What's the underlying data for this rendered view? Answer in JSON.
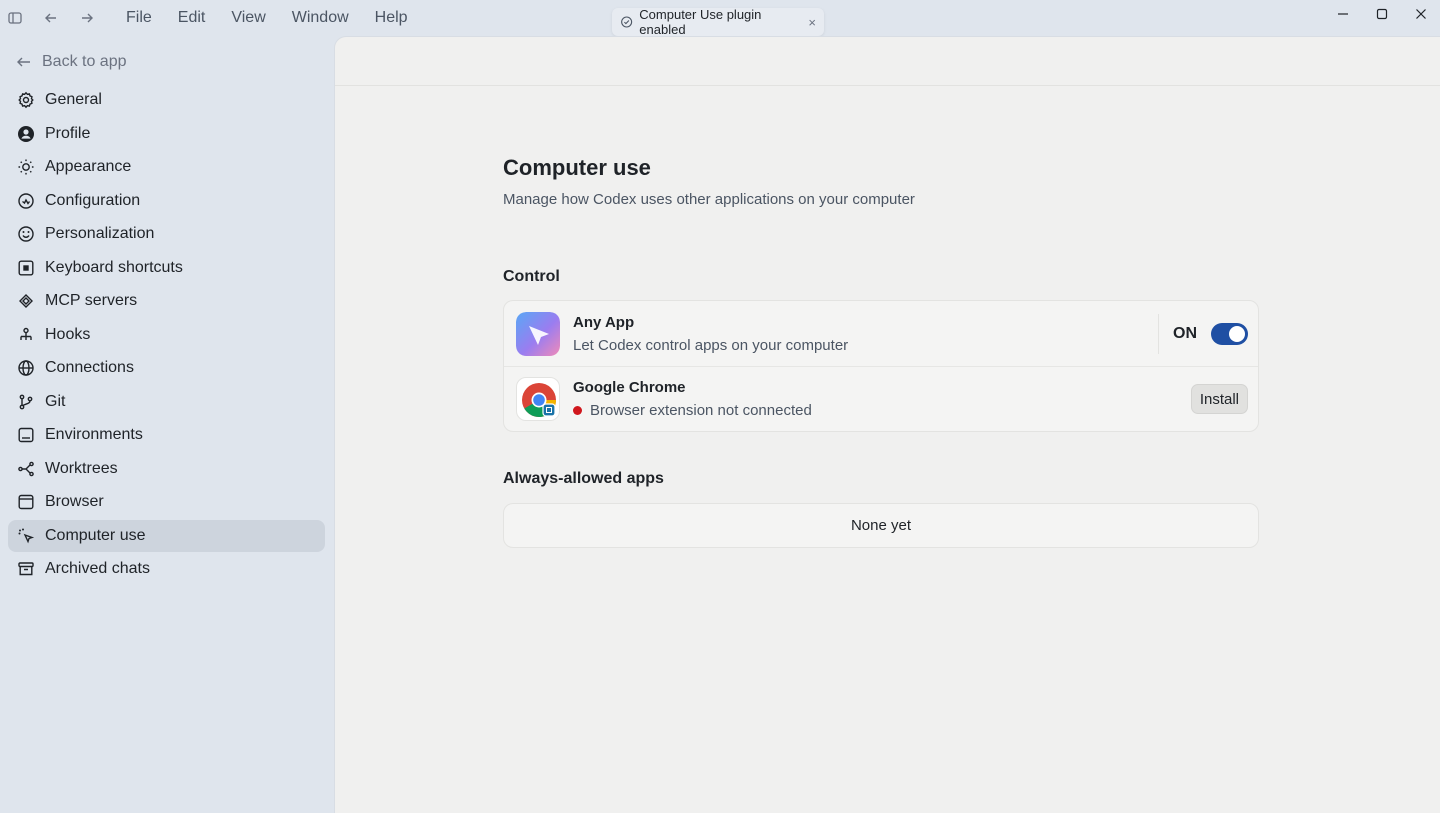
{
  "menu": [
    "File",
    "Edit",
    "View",
    "Window",
    "Help"
  ],
  "toast": {
    "text": "Computer Use plugin enabled",
    "close": "×"
  },
  "sidebar": {
    "back_label": "Back to app",
    "items": [
      {
        "label": "General",
        "icon": "gear-icon"
      },
      {
        "label": "Profile",
        "icon": "user-icon"
      },
      {
        "label": "Appearance",
        "icon": "sun-icon"
      },
      {
        "label": "Configuration",
        "icon": "config-icon"
      },
      {
        "label": "Personalization",
        "icon": "smile-icon"
      },
      {
        "label": "Keyboard shortcuts",
        "icon": "keyboard-icon"
      },
      {
        "label": "MCP servers",
        "icon": "mcp-icon"
      },
      {
        "label": "Hooks",
        "icon": "hooks-icon"
      },
      {
        "label": "Connections",
        "icon": "globe-icon"
      },
      {
        "label": "Git",
        "icon": "git-icon"
      },
      {
        "label": "Environments",
        "icon": "monitor-icon"
      },
      {
        "label": "Worktrees",
        "icon": "worktree-icon"
      },
      {
        "label": "Browser",
        "icon": "browser-icon"
      },
      {
        "label": "Computer use",
        "icon": "computer-use-icon",
        "active": true
      },
      {
        "label": "Archived chats",
        "icon": "archive-icon"
      }
    ]
  },
  "main": {
    "title": "Computer use",
    "subtitle": "Manage how Codex uses other applications on your computer",
    "control_title": "Control",
    "rows": [
      {
        "title": "Any App",
        "desc": "Let Codex control apps on your computer",
        "state": "ON"
      },
      {
        "title": "Google Chrome",
        "desc": "Browser extension not connected",
        "action": "Install"
      }
    ],
    "allowed_title": "Always-allowed apps",
    "allowed_empty": "None yet"
  },
  "colors": {
    "toggle_on": "#1f4fa3",
    "status_error": "#d0171d",
    "active_nav": "#cdd4dd"
  }
}
